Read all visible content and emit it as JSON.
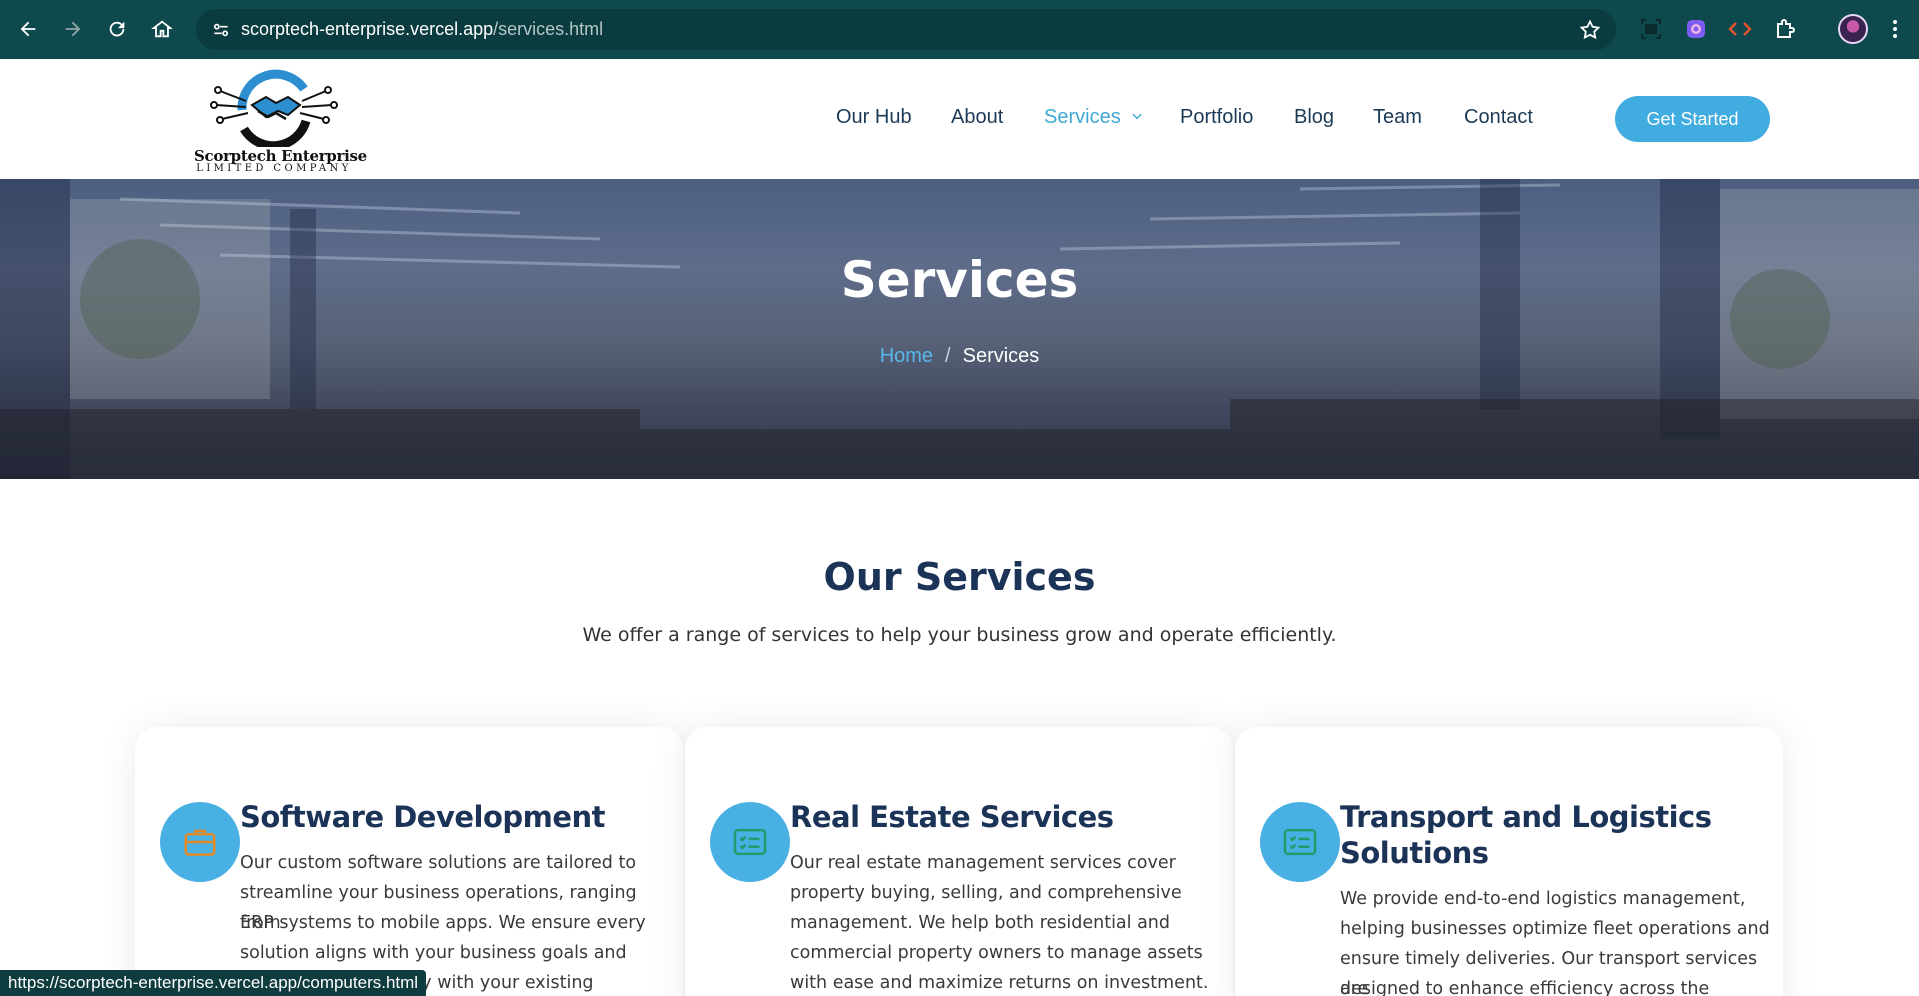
{
  "browser": {
    "url_host": "scorptech-enterprise.vercel.app",
    "url_path": "/services.html",
    "status_link": "https://scorptech-enterprise.vercel.app/computers.html"
  },
  "logo": {
    "name": "Scorptech Enterprise",
    "subtitle": "LIMITED COMPANY"
  },
  "nav": {
    "items": [
      {
        "label": "Our Hub"
      },
      {
        "label": "About"
      },
      {
        "label": "Services"
      },
      {
        "label": "Portfolio"
      },
      {
        "label": "Blog"
      },
      {
        "label": "Team"
      },
      {
        "label": "Contact"
      }
    ],
    "cta": "Get Started"
  },
  "hero": {
    "title": "Services",
    "breadcrumb_home": "Home",
    "breadcrumb_sep": "/",
    "breadcrumb_current": "Services"
  },
  "section": {
    "title": "Our Services",
    "subtitle": "We offer a range of services to help your business grow and operate efficiently."
  },
  "cards": [
    {
      "title": "Software Development",
      "icon": "briefcase-icon",
      "lines": [
        "Our custom software solutions are tailored to",
        "streamline your business operations, ranging from",
        "ERP systems to mobile apps. We ensure every",
        "solution aligns with your business goals and",
        "integrates seamlessly with your existing systems."
      ]
    },
    {
      "title": "Real Estate Services",
      "icon": "card-list-icon",
      "lines": [
        "Our real estate management services cover",
        "property buying, selling, and comprehensive",
        "management. We help both residential and",
        "commercial property owners to manage assets",
        "with ease and maximize returns on investment."
      ]
    },
    {
      "title_line1": "Transport and Logistics",
      "title_line2": "Solutions",
      "icon": "card-list-icon",
      "lines": [
        "We provide end-to-end logistics management,",
        "helping businesses optimize fleet operations and",
        "ensure timely deliveries. Our transport services are",
        "designed to enhance efficiency across the supply"
      ]
    }
  ],
  "colors": {
    "chrome": "#0e4a4d",
    "accent": "#41ace0",
    "heading": "#1c3358",
    "icon_orange": "#e08a2a",
    "icon_green": "#1f9d6c"
  }
}
